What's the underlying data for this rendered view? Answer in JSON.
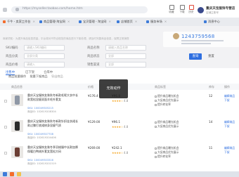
{
  "browser": {
    "url": "https://myseller.taobao.com/home.htm",
    "tools": [
      "收藏",
      "下载",
      "历史",
      "设置"
    ],
    "store_name": "重庆天宝服饰专营店",
    "store_sub": "店铺主账号"
  },
  "tabs": [
    {
      "label": "千牛 - 卖家工作台"
    },
    {
      "label": "商品管理-淘宝网"
    },
    {
      "label": "宝贝管理 - 淘宝网"
    },
    {
      "label": "店铺首页"
    },
    {
      "label": "服务市场"
    },
    {
      "label": "消息中心"
    }
  ],
  "phone_popup": {
    "number": "1243759568"
  },
  "notice": "商家须知：为提升商品信息质量，平台将对不符合规范的商品进行下架处理，请及时完善商品信息，保障正常销售",
  "filters": {
    "sku_label": "SKU编码",
    "sku_placeholder": "请输入SKU编码",
    "name_label": "商品名称",
    "name_placeholder": "请输入商品名称",
    "category_label": "商品分类",
    "category_placeholder": "全部分类",
    "status_label": "商品状态",
    "status_placeholder": "全部",
    "price_label": "商品价格",
    "price_placeholder": "请输入",
    "channel_label": "销售渠道",
    "channel_placeholder": "全部",
    "search_button": "查询",
    "reset_button": "重置"
  },
  "panel": {
    "tabs": [
      "出售中",
      "已下架",
      "仓库中"
    ],
    "sub_tabs": [
      "商品批量操作",
      "批量下架商品",
      "导出商品"
    ]
  },
  "table": {
    "headers": [
      "商品信息",
      "价格",
      "评价",
      "商品标签",
      "库存",
      "操作"
    ],
    "rows": [
      {
        "name": "重庆天宝服饰女装秋冬新款毛呢大衣中长款宽松显瘦双面羊毛外套女",
        "sku": "SKU: 100049305215",
        "id": "商品ID: 102619208304",
        "price": "¥176.4",
        "price_orig": "¥96.8",
        "stars": "★★★★☆",
        "rating": "4.8",
        "tags": [
          "提升商品曝光机会",
          "大促商品优先展示",
          "提升转化率"
        ],
        "stock": "12",
        "ops": [
          "编辑商品",
          "下架"
        ],
        "thumb_color": "#8f98a6"
      },
      {
        "name": "重庆天宝服饰女装秋冬新款针织连衣裙长款过膝打底裙修身显瘦气质",
        "sku": "SKU: 100049307708",
        "id": "商品ID: 102619204406",
        "price": "¥129.00",
        "price_orig": "¥96.1",
        "stars": "★★★★☆",
        "rating": "4.8",
        "tags": [
          "提升商品曝光机会",
          "大促商品优先展示"
        ],
        "stock": "14",
        "ops": [
          "编辑商品",
          "下架"
        ],
        "thumb_color": "#2b2b2b"
      },
      {
        "name": "重庆天宝服饰女装冬季羽绒服中长款加厚保暖白鸭绒外套女宽松大码",
        "sku": "SKU: 100049303316",
        "id": "商品ID: 102619201519",
        "price": "¥269.00",
        "price_orig": "¥242.1",
        "stars": "★★★★☆",
        "rating": "4.8",
        "tags": [
          "提升商品曝光机会",
          "大促商品优先展示",
          "提升转化率"
        ],
        "stock": "11",
        "ops": [
          "编辑商品",
          "下架"
        ],
        "thumb_color": "#6b3e34"
      }
    ]
  },
  "toast": "无效动作",
  "colors": {
    "accent": "#2f6fe0",
    "star": "#f5a623",
    "link": "#2f6fe0"
  }
}
